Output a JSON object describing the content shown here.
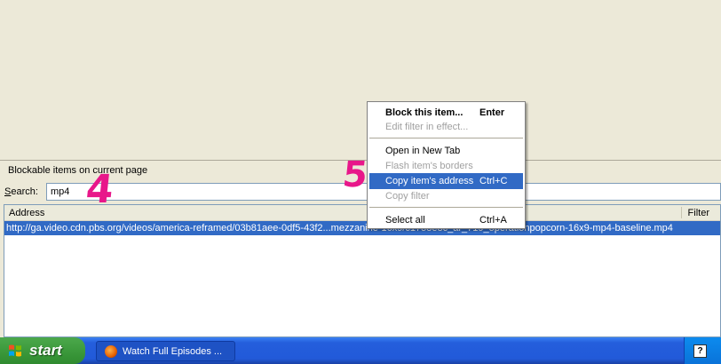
{
  "panel": {
    "title": "Blockable items on current page"
  },
  "search": {
    "label_s": "S",
    "label_rest": "earch:",
    "value": "mp4"
  },
  "list": {
    "headers": {
      "address": "Address",
      "filter": "Filter"
    },
    "rows": [
      {
        "address": "http://ga.video.cdn.pbs.org/videos/america-reframed/03b81aee-0df5-43f2...mezzanine-16x9/c1758e8c_ar_719_operationpopcorn-16x9-mp4-baseline.mp4"
      }
    ]
  },
  "context_menu": {
    "items": [
      {
        "label": "Block this item...",
        "shortcut": "Enter",
        "bold": true,
        "disabled": false
      },
      {
        "label": "Edit filter in effect...",
        "shortcut": "",
        "disabled": true
      },
      {
        "label": "Open in New Tab",
        "shortcut": "",
        "disabled": false
      },
      {
        "label": "Flash item's borders",
        "shortcut": "",
        "disabled": true
      },
      {
        "label": "Copy item's address",
        "shortcut": "Ctrl+C",
        "highlighted": true,
        "disabled": false
      },
      {
        "label": "Copy filter",
        "shortcut": "",
        "disabled": true
      },
      {
        "label": "Select all",
        "shortcut": "Ctrl+A",
        "disabled": false
      }
    ]
  },
  "annotations": {
    "four": "4",
    "five": "5"
  },
  "taskbar": {
    "start_label": "start",
    "task_title": "Watch Full Episodes ...",
    "tray_icon": "help-icon",
    "tray_help": "?"
  },
  "colors": {
    "selection": "#316AC5",
    "annotation": "#E8178A",
    "taskbar": "#245EDC",
    "start": "#3C9A3C"
  }
}
